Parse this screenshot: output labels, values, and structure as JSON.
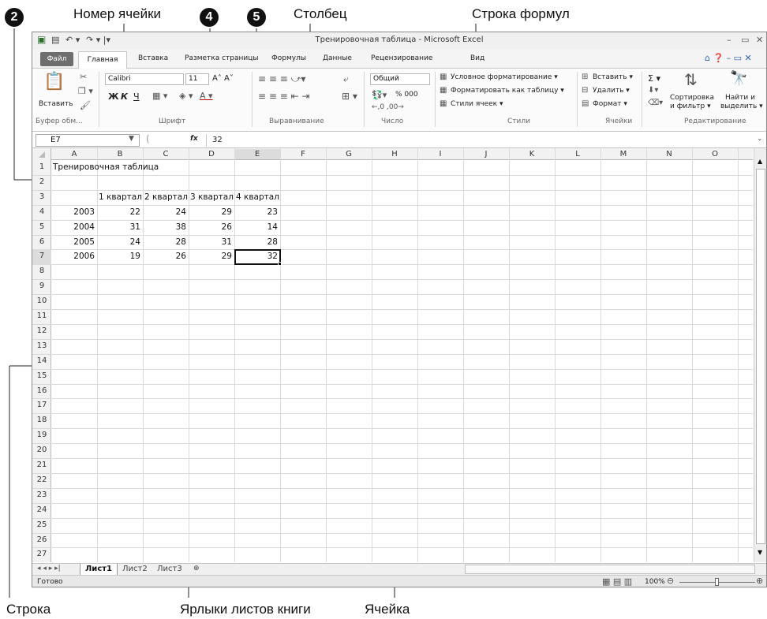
{
  "callouts": {
    "cell_number": "Номер ячейки",
    "column": "Столбец",
    "formula_bar": "Строка формул",
    "row": "Строка",
    "sheet_tabs": "Ярлыки листов книги",
    "cell": "Ячейка",
    "badge_2": "2",
    "badge_4": "4",
    "badge_5": "5"
  },
  "window": {
    "title": "Тренировочная таблица - Microsoft Excel",
    "qat_undo": "↶ ▾",
    "qat_redo": "↷ ▾ |▾",
    "win_min": "–",
    "win_max": "▭",
    "win_close": "✕"
  },
  "tabs": {
    "file": "Файл",
    "home": "Главная",
    "items": [
      "Вставка",
      "Разметка страницы",
      "Формулы",
      "Данные",
      "Рецензирование",
      "Вид"
    ]
  },
  "ribbon": {
    "paste": "Вставить",
    "font_name": "Calibri",
    "font_size": "11",
    "bold": "Ж",
    "italic": "К",
    "underline": "Ч",
    "grow_font": "A˄ A˅",
    "number_format": "Общий",
    "percent": "% 000",
    "cond_format": "Условное форматирование ▾",
    "format_table": "Форматировать как таблицу ▾",
    "cell_styles": "Стили ячеек ▾",
    "insert": "Вставить ▾",
    "delete": "Удалить ▾",
    "format": "Формат ▾",
    "sum": "Σ ▾",
    "sort_1": "Сортировка",
    "sort_2": "и фильтр ▾",
    "find_1": "Найти и",
    "find_2": "выделить ▾",
    "groups": [
      "Буфер обм...",
      "Шрифт",
      "Выравнивание",
      "Число",
      "Стили",
      "Ячейки",
      "Редактирование"
    ]
  },
  "formula_bar": {
    "name_box": "E7",
    "fx": "fx",
    "value": "32"
  },
  "grid": {
    "columns": [
      "A",
      "B",
      "C",
      "D",
      "E",
      "F",
      "G",
      "H",
      "I",
      "J",
      "K",
      "L",
      "M",
      "N",
      "O"
    ],
    "row_count": 27,
    "selected_cell": "E7",
    "cells": [
      {
        "ref": "A1",
        "text": "Тренировочная таблица",
        "align": "left"
      },
      {
        "ref": "B3",
        "text": "1 квартал",
        "align": "left"
      },
      {
        "ref": "C3",
        "text": "2 квартал",
        "align": "left"
      },
      {
        "ref": "D3",
        "text": "3 квартал",
        "align": "left"
      },
      {
        "ref": "E3",
        "text": "4 квартал",
        "align": "left"
      },
      {
        "ref": "A4",
        "text": "2003",
        "align": "right"
      },
      {
        "ref": "B4",
        "text": "22",
        "align": "right"
      },
      {
        "ref": "C4",
        "text": "24",
        "align": "right"
      },
      {
        "ref": "D4",
        "text": "29",
        "align": "right"
      },
      {
        "ref": "E4",
        "text": "23",
        "align": "right"
      },
      {
        "ref": "A5",
        "text": "2004",
        "align": "right"
      },
      {
        "ref": "B5",
        "text": "31",
        "align": "right"
      },
      {
        "ref": "C5",
        "text": "38",
        "align": "right"
      },
      {
        "ref": "D5",
        "text": "26",
        "align": "right"
      },
      {
        "ref": "E5",
        "text": "14",
        "align": "right"
      },
      {
        "ref": "A6",
        "text": "2005",
        "align": "right"
      },
      {
        "ref": "B6",
        "text": "24",
        "align": "right"
      },
      {
        "ref": "C6",
        "text": "28",
        "align": "right"
      },
      {
        "ref": "D6",
        "text": "31",
        "align": "right"
      },
      {
        "ref": "E6",
        "text": "28",
        "align": "right"
      },
      {
        "ref": "A7",
        "text": "2006",
        "align": "right"
      },
      {
        "ref": "B7",
        "text": "19",
        "align": "right"
      },
      {
        "ref": "C7",
        "text": "26",
        "align": "right"
      },
      {
        "ref": "D7",
        "text": "29",
        "align": "right"
      },
      {
        "ref": "E7",
        "text": "32",
        "align": "right"
      }
    ]
  },
  "sheets": {
    "nav": "◂ ◂ ▸ ▸|",
    "tabs": [
      "Лист1",
      "Лист2",
      "Лист3"
    ],
    "active": "Лист1"
  },
  "status": {
    "ready": "Готово",
    "zoom": "100%"
  }
}
